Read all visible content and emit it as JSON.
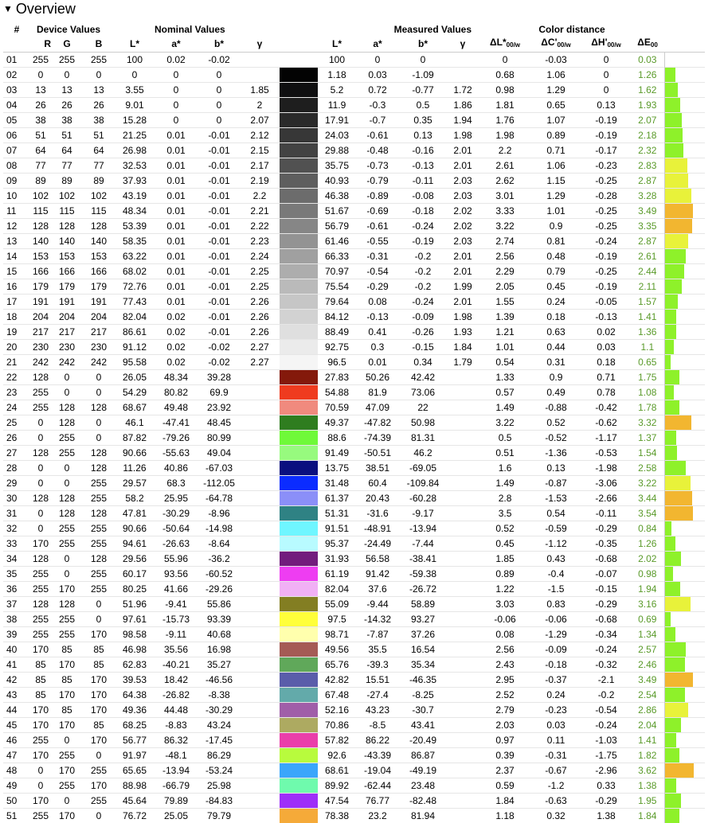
{
  "title": "Overview",
  "groups": {
    "device": "Device Values",
    "nominal": "Nominal Values",
    "measured": "Measured Values",
    "distance": "Color distance"
  },
  "columns": {
    "num": "#",
    "r": "R",
    "g": "G",
    "b": "B",
    "l": "L*",
    "a": "a*",
    "bstar": "b*",
    "gamma": "γ",
    "ml": "L*",
    "ma": "a*",
    "mb": "b*",
    "mgamma": "γ",
    "dl": "ΔL*",
    "dc": "ΔC'",
    "dh": "ΔH'",
    "de": "ΔE",
    "sub00w": "00/w",
    "sub00": "00"
  },
  "rows": [
    {
      "n": "01",
      "r": 255,
      "g": 255,
      "b": 255,
      "L": "100",
      "A": "0.02",
      "B": "-0.02",
      "gam": "",
      "sw": "#ffffff",
      "mL": "100",
      "mA": "0",
      "mB": "0",
      "mg": "",
      "dL": "0",
      "dC": "-0.03",
      "dH": "0",
      "dE": "0.03",
      "dEv": 0.03
    },
    {
      "n": "02",
      "r": 0,
      "g": 0,
      "b": 0,
      "L": "0",
      "A": "0",
      "B": "0",
      "gam": "",
      "sw": "#030303",
      "mL": "1.18",
      "mA": "0.03",
      "mB": "-1.09",
      "mg": "",
      "dL": "0.68",
      "dC": "1.06",
      "dH": "0",
      "dE": "1.26",
      "dEv": 1.26
    },
    {
      "n": "03",
      "r": 13,
      "g": 13,
      "b": 13,
      "L": "3.55",
      "A": "0",
      "B": "0",
      "gam": "1.85",
      "sw": "#0f0f10",
      "mL": "5.2",
      "mA": "0.72",
      "mB": "-0.77",
      "mg": "1.72",
      "dL": "0.98",
      "dC": "1.29",
      "dH": "0",
      "dE": "1.62",
      "dEv": 1.62
    },
    {
      "n": "04",
      "r": 26,
      "g": 26,
      "b": 26,
      "L": "9.01",
      "A": "0",
      "B": "0",
      "gam": "2",
      "sw": "#1e1e1e",
      "mL": "11.9",
      "mA": "-0.3",
      "mB": "0.5",
      "mg": "1.86",
      "dL": "1.81",
      "dC": "0.65",
      "dH": "0.13",
      "dE": "1.93",
      "dEv": 1.93
    },
    {
      "n": "05",
      "r": 38,
      "g": 38,
      "b": 38,
      "L": "15.28",
      "A": "0",
      "B": "0",
      "gam": "2.07",
      "sw": "#2a2a2a",
      "mL": "17.91",
      "mA": "-0.7",
      "mB": "0.35",
      "mg": "1.94",
      "dL": "1.76",
      "dC": "1.07",
      "dH": "-0.19",
      "dE": "2.07",
      "dEv": 2.07
    },
    {
      "n": "06",
      "r": 51,
      "g": 51,
      "b": 51,
      "L": "21.25",
      "A": "0.01",
      "B": "-0.01",
      "gam": "2.12",
      "sw": "#373737",
      "mL": "24.03",
      "mA": "-0.61",
      "mB": "0.13",
      "mg": "1.98",
      "dL": "1.98",
      "dC": "0.89",
      "dH": "-0.19",
      "dE": "2.18",
      "dEv": 2.18
    },
    {
      "n": "07",
      "r": 64,
      "g": 64,
      "b": 64,
      "L": "26.98",
      "A": "0.01",
      "B": "-0.01",
      "gam": "2.15",
      "sw": "#434343",
      "mL": "29.88",
      "mA": "-0.48",
      "mB": "-0.16",
      "mg": "2.01",
      "dL": "2.2",
      "dC": "0.71",
      "dH": "-0.17",
      "dE": "2.32",
      "dEv": 2.32
    },
    {
      "n": "08",
      "r": 77,
      "g": 77,
      "b": 77,
      "L": "32.53",
      "A": "0.01",
      "B": "-0.01",
      "gam": "2.17",
      "sw": "#515151",
      "mL": "35.75",
      "mA": "-0.73",
      "mB": "-0.13",
      "mg": "2.01",
      "dL": "2.61",
      "dC": "1.06",
      "dH": "-0.23",
      "dE": "2.83",
      "dEv": 2.83
    },
    {
      "n": "09",
      "r": 89,
      "g": 89,
      "b": 89,
      "L": "37.93",
      "A": "0.01",
      "B": "-0.01",
      "gam": "2.19",
      "sw": "#5e5e5e",
      "mL": "40.93",
      "mA": "-0.79",
      "mB": "-0.11",
      "mg": "2.03",
      "dL": "2.62",
      "dC": "1.15",
      "dH": "-0.25",
      "dE": "2.87",
      "dEv": 2.87
    },
    {
      "n": "10",
      "r": 102,
      "g": 102,
      "b": 102,
      "L": "43.19",
      "A": "0.01",
      "B": "-0.01",
      "gam": "2.2",
      "sw": "#6c6c6c",
      "mL": "46.38",
      "mA": "-0.89",
      "mB": "-0.08",
      "mg": "2.03",
      "dL": "3.01",
      "dC": "1.29",
      "dH": "-0.28",
      "dE": "3.28",
      "dEv": 3.28
    },
    {
      "n": "11",
      "r": 115,
      "g": 115,
      "b": 115,
      "L": "48.34",
      "A": "0.01",
      "B": "-0.01",
      "gam": "2.21",
      "sw": "#797979",
      "mL": "51.67",
      "mA": "-0.69",
      "mB": "-0.18",
      "mg": "2.02",
      "dL": "3.33",
      "dC": "1.01",
      "dH": "-0.25",
      "dE": "3.49",
      "dEv": 3.49
    },
    {
      "n": "12",
      "r": 128,
      "g": 128,
      "b": 128,
      "L": "53.39",
      "A": "0.01",
      "B": "-0.01",
      "gam": "2.22",
      "sw": "#868686",
      "mL": "56.79",
      "mA": "-0.61",
      "mB": "-0.24",
      "mg": "2.02",
      "dL": "3.22",
      "dC": "0.9",
      "dH": "-0.25",
      "dE": "3.35",
      "dEv": 3.35
    },
    {
      "n": "13",
      "r": 140,
      "g": 140,
      "b": 140,
      "L": "58.35",
      "A": "0.01",
      "B": "-0.01",
      "gam": "2.23",
      "sw": "#939393",
      "mL": "61.46",
      "mA": "-0.55",
      "mB": "-0.19",
      "mg": "2.03",
      "dL": "2.74",
      "dC": "0.81",
      "dH": "-0.24",
      "dE": "2.87",
      "dEv": 2.87
    },
    {
      "n": "14",
      "r": 153,
      "g": 153,
      "b": 153,
      "L": "63.22",
      "A": "0.01",
      "B": "-0.01",
      "gam": "2.24",
      "sw": "#a0a0a0",
      "mL": "66.33",
      "mA": "-0.31",
      "mB": "-0.2",
      "mg": "2.01",
      "dL": "2.56",
      "dC": "0.48",
      "dH": "-0.19",
      "dE": "2.61",
      "dEv": 2.61
    },
    {
      "n": "15",
      "r": 166,
      "g": 166,
      "b": 166,
      "L": "68.02",
      "A": "0.01",
      "B": "-0.01",
      "gam": "2.25",
      "sw": "#adadad",
      "mL": "70.97",
      "mA": "-0.54",
      "mB": "-0.2",
      "mg": "2.01",
      "dL": "2.29",
      "dC": "0.79",
      "dH": "-0.25",
      "dE": "2.44",
      "dEv": 2.44
    },
    {
      "n": "16",
      "r": 179,
      "g": 179,
      "b": 179,
      "L": "72.76",
      "A": "0.01",
      "B": "-0.01",
      "gam": "2.25",
      "sw": "#bababa",
      "mL": "75.54",
      "mA": "-0.29",
      "mB": "-0.2",
      "mg": "1.99",
      "dL": "2.05",
      "dC": "0.45",
      "dH": "-0.19",
      "dE": "2.11",
      "dEv": 2.11
    },
    {
      "n": "17",
      "r": 191,
      "g": 191,
      "b": 191,
      "L": "77.43",
      "A": "0.01",
      "B": "-0.01",
      "gam": "2.26",
      "sw": "#c6c6c6",
      "mL": "79.64",
      "mA": "0.08",
      "mB": "-0.24",
      "mg": "2.01",
      "dL": "1.55",
      "dC": "0.24",
      "dH": "-0.05",
      "dE": "1.57",
      "dEv": 1.57
    },
    {
      "n": "18",
      "r": 204,
      "g": 204,
      "b": 204,
      "L": "82.04",
      "A": "0.02",
      "B": "-0.01",
      "gam": "2.26",
      "sw": "#d2d2d2",
      "mL": "84.12",
      "mA": "-0.13",
      "mB": "-0.09",
      "mg": "1.98",
      "dL": "1.39",
      "dC": "0.18",
      "dH": "-0.13",
      "dE": "1.41",
      "dEv": 1.41
    },
    {
      "n": "19",
      "r": 217,
      "g": 217,
      "b": 217,
      "L": "86.61",
      "A": "0.02",
      "B": "-0.01",
      "gam": "2.26",
      "sw": "#dfdfdf",
      "mL": "88.49",
      "mA": "0.41",
      "mB": "-0.26",
      "mg": "1.93",
      "dL": "1.21",
      "dC": "0.63",
      "dH": "0.02",
      "dE": "1.36",
      "dEv": 1.36
    },
    {
      "n": "20",
      "r": 230,
      "g": 230,
      "b": 230,
      "L": "91.12",
      "A": "0.02",
      "B": "-0.02",
      "gam": "2.27",
      "sw": "#ebebeb",
      "mL": "92.75",
      "mA": "0.3",
      "mB": "-0.15",
      "mg": "1.84",
      "dL": "1.01",
      "dC": "0.44",
      "dH": "0.03",
      "dE": "1.1",
      "dEv": 1.1
    },
    {
      "n": "21",
      "r": 242,
      "g": 242,
      "b": 242,
      "L": "95.58",
      "A": "0.02",
      "B": "-0.02",
      "gam": "2.27",
      "sw": "#f5f5f5",
      "mL": "96.5",
      "mA": "0.01",
      "mB": "0.34",
      "mg": "1.79",
      "dL": "0.54",
      "dC": "0.31",
      "dH": "0.18",
      "dE": "0.65",
      "dEv": 0.65
    },
    {
      "n": "22",
      "r": 128,
      "g": 0,
      "b": 0,
      "L": "26.05",
      "A": "48.34",
      "B": "39.28",
      "gam": "",
      "sw": "#84190b",
      "mL": "27.83",
      "mA": "50.26",
      "mB": "42.42",
      "mg": "",
      "dL": "1.33",
      "dC": "0.9",
      "dH": "0.71",
      "dE": "1.75",
      "dEv": 1.75
    },
    {
      "n": "23",
      "r": 255,
      "g": 0,
      "b": 0,
      "L": "54.29",
      "A": "80.82",
      "B": "69.9",
      "gam": "",
      "sw": "#ef3b1f",
      "mL": "54.88",
      "mA": "81.9",
      "mB": "73.06",
      "mg": "",
      "dL": "0.57",
      "dC": "0.49",
      "dH": "0.78",
      "dE": "1.08",
      "dEv": 1.08
    },
    {
      "n": "24",
      "r": 255,
      "g": 128,
      "b": 128,
      "L": "68.67",
      "A": "49.48",
      "B": "23.92",
      "gam": "",
      "sw": "#f08a7e",
      "mL": "70.59",
      "mA": "47.09",
      "mB": "22",
      "mg": "",
      "dL": "1.49",
      "dC": "-0.88",
      "dH": "-0.42",
      "dE": "1.78",
      "dEv": 1.78
    },
    {
      "n": "25",
      "r": 0,
      "g": 128,
      "b": 0,
      "L": "46.1",
      "A": "-47.41",
      "B": "48.45",
      "gam": "",
      "sw": "#2f7d1f",
      "mL": "49.37",
      "mA": "-47.82",
      "mB": "50.98",
      "mg": "",
      "dL": "3.22",
      "dC": "0.52",
      "dH": "-0.62",
      "dE": "3.32",
      "dEv": 3.32
    },
    {
      "n": "26",
      "r": 0,
      "g": 255,
      "b": 0,
      "L": "87.82",
      "A": "-79.26",
      "B": "80.99",
      "gam": "",
      "sw": "#6ff939",
      "mL": "88.6",
      "mA": "-74.39",
      "mB": "81.31",
      "mg": "",
      "dL": "0.5",
      "dC": "-0.52",
      "dH": "-1.17",
      "dE": "1.37",
      "dEv": 1.37
    },
    {
      "n": "27",
      "r": 128,
      "g": 255,
      "b": 128,
      "L": "90.66",
      "A": "-55.63",
      "B": "49.04",
      "gam": "",
      "sw": "#97fa7e",
      "mL": "91.49",
      "mA": "-50.51",
      "mB": "46.2",
      "mg": "",
      "dL": "0.51",
      "dC": "-1.36",
      "dH": "-0.53",
      "dE": "1.54",
      "dEv": 1.54
    },
    {
      "n": "28",
      "r": 0,
      "g": 0,
      "b": 128,
      "L": "11.26",
      "A": "40.86",
      "B": "-67.03",
      "gam": "",
      "sw": "#0a0f7f",
      "mL": "13.75",
      "mA": "38.51",
      "mB": "-69.05",
      "mg": "",
      "dL": "1.6",
      "dC": "0.13",
      "dH": "-1.98",
      "dE": "2.58",
      "dEv": 2.58
    },
    {
      "n": "29",
      "r": 0,
      "g": 0,
      "b": 255,
      "L": "29.57",
      "A": "68.3",
      "B": "-112.05",
      "gam": "",
      "sw": "#0b2cff",
      "mL": "31.48",
      "mA": "60.4",
      "mB": "-109.84",
      "mg": "",
      "dL": "1.49",
      "dC": "-0.87",
      "dH": "-3.06",
      "dE": "3.22",
      "dEv": 3.22
    },
    {
      "n": "30",
      "r": 128,
      "g": 128,
      "b": 255,
      "L": "58.2",
      "A": "25.95",
      "B": "-64.78",
      "gam": "",
      "sw": "#8b8ff8",
      "mL": "61.37",
      "mA": "20.43",
      "mB": "-60.28",
      "mg": "",
      "dL": "2.8",
      "dC": "-1.53",
      "dH": "-2.66",
      "dE": "3.44",
      "dEv": 3.44
    },
    {
      "n": "31",
      "r": 0,
      "g": 128,
      "b": 128,
      "L": "47.81",
      "A": "-30.29",
      "B": "-8.96",
      "gam": "",
      "sw": "#2f8284",
      "mL": "51.31",
      "mA": "-31.6",
      "mB": "-9.17",
      "mg": "",
      "dL": "3.5",
      "dC": "0.54",
      "dH": "-0.11",
      "dE": "3.54",
      "dEv": 3.54
    },
    {
      "n": "32",
      "r": 0,
      "g": 255,
      "b": 255,
      "L": "90.66",
      "A": "-50.64",
      "B": "-14.98",
      "gam": "",
      "sw": "#6ff6ff",
      "mL": "91.51",
      "mA": "-48.91",
      "mB": "-13.94",
      "mg": "",
      "dL": "0.52",
      "dC": "-0.59",
      "dH": "-0.29",
      "dE": "0.84",
      "dEv": 0.84
    },
    {
      "n": "33",
      "r": 170,
      "g": 255,
      "b": 255,
      "L": "94.61",
      "A": "-26.63",
      "B": "-8.64",
      "gam": "",
      "sw": "#b8fbff",
      "mL": "95.37",
      "mA": "-24.49",
      "mB": "-7.44",
      "mg": "",
      "dL": "0.45",
      "dC": "-1.12",
      "dH": "-0.35",
      "dE": "1.26",
      "dEv": 1.26
    },
    {
      "n": "34",
      "r": 128,
      "g": 0,
      "b": 128,
      "L": "29.56",
      "A": "55.96",
      "B": "-36.2",
      "gam": "",
      "sw": "#721c7d",
      "mL": "31.93",
      "mA": "56.58",
      "mB": "-38.41",
      "mg": "",
      "dL": "1.85",
      "dC": "0.43",
      "dH": "-0.68",
      "dE": "2.02",
      "dEv": 2.02
    },
    {
      "n": "35",
      "r": 255,
      "g": 0,
      "b": 255,
      "L": "60.17",
      "A": "93.56",
      "B": "-60.52",
      "gam": "",
      "sw": "#ee3df2",
      "mL": "61.19",
      "mA": "91.42",
      "mB": "-59.38",
      "mg": "",
      "dL": "0.89",
      "dC": "-0.4",
      "dH": "-0.07",
      "dE": "0.98",
      "dEv": 0.98
    },
    {
      "n": "36",
      "r": 255,
      "g": 170,
      "b": 255,
      "L": "80.25",
      "A": "41.66",
      "B": "-29.26",
      "gam": "",
      "sw": "#f1b0f5",
      "mL": "82.04",
      "mA": "37.6",
      "mB": "-26.72",
      "mg": "",
      "dL": "1.22",
      "dC": "-1.5",
      "dH": "-0.15",
      "dE": "1.94",
      "dEv": 1.94
    },
    {
      "n": "37",
      "r": 128,
      "g": 128,
      "b": 0,
      "L": "51.96",
      "A": "-9.41",
      "B": "55.86",
      "gam": "",
      "sw": "#837e22",
      "mL": "55.09",
      "mA": "-9.44",
      "mB": "58.89",
      "mg": "",
      "dL": "3.03",
      "dC": "0.83",
      "dH": "-0.29",
      "dE": "3.16",
      "dEv": 3.16
    },
    {
      "n": "38",
      "r": 255,
      "g": 255,
      "b": 0,
      "L": "97.61",
      "A": "-15.73",
      "B": "93.39",
      "gam": "",
      "sw": "#ffff3a",
      "mL": "97.5",
      "mA": "-14.32",
      "mB": "93.27",
      "mg": "",
      "dL": "-0.06",
      "dC": "-0.06",
      "dH": "-0.68",
      "dE": "0.69",
      "dEv": 0.69
    },
    {
      "n": "39",
      "r": 255,
      "g": 255,
      "b": 170,
      "L": "98.58",
      "A": "-9.11",
      "B": "40.68",
      "gam": "",
      "sw": "#ffffad",
      "mL": "98.71",
      "mA": "-7.87",
      "mB": "37.26",
      "mg": "",
      "dL": "0.08",
      "dC": "-1.29",
      "dH": "-0.34",
      "dE": "1.34",
      "dEv": 1.34
    },
    {
      "n": "40",
      "r": 170,
      "g": 85,
      "b": 85,
      "L": "46.98",
      "A": "35.56",
      "B": "16.98",
      "gam": "",
      "sw": "#a55b55",
      "mL": "49.56",
      "mA": "35.5",
      "mB": "16.54",
      "mg": "",
      "dL": "2.56",
      "dC": "-0.09",
      "dH": "-0.24",
      "dE": "2.57",
      "dEv": 2.57
    },
    {
      "n": "41",
      "r": 85,
      "g": 170,
      "b": 85,
      "L": "62.83",
      "A": "-40.21",
      "B": "35.27",
      "gam": "",
      "sw": "#60a85a",
      "mL": "65.76",
      "mA": "-39.3",
      "mB": "35.34",
      "mg": "",
      "dL": "2.43",
      "dC": "-0.18",
      "dH": "-0.32",
      "dE": "2.46",
      "dEv": 2.46
    },
    {
      "n": "42",
      "r": 85,
      "g": 85,
      "b": 170,
      "L": "39.53",
      "A": "18.42",
      "B": "-46.56",
      "gam": "",
      "sw": "#5a5daa",
      "mL": "42.82",
      "mA": "15.51",
      "mB": "-46.35",
      "mg": "",
      "dL": "2.95",
      "dC": "-0.37",
      "dH": "-2.1",
      "dE": "3.49",
      "dEv": 3.49
    },
    {
      "n": "43",
      "r": 85,
      "g": 170,
      "b": 170,
      "L": "64.38",
      "A": "-26.82",
      "B": "-8.38",
      "gam": "",
      "sw": "#63aaaa",
      "mL": "67.48",
      "mA": "-27.4",
      "mB": "-8.25",
      "mg": "",
      "dL": "2.52",
      "dC": "0.24",
      "dH": "-0.2",
      "dE": "2.54",
      "dEv": 2.54
    },
    {
      "n": "44",
      "r": 170,
      "g": 85,
      "b": 170,
      "L": "49.36",
      "A": "44.48",
      "B": "-30.29",
      "gam": "",
      "sw": "#a05ea8",
      "mL": "52.16",
      "mA": "43.23",
      "mB": "-30.7",
      "mg": "",
      "dL": "2.79",
      "dC": "-0.23",
      "dH": "-0.54",
      "dE": "2.86",
      "dEv": 2.86
    },
    {
      "n": "45",
      "r": 170,
      "g": 170,
      "b": 85,
      "L": "68.25",
      "A": "-8.83",
      "B": "43.24",
      "gam": "",
      "sw": "#adaa61",
      "mL": "70.86",
      "mA": "-8.5",
      "mB": "43.41",
      "mg": "",
      "dL": "2.03",
      "dC": "0.03",
      "dH": "-0.24",
      "dE": "2.04",
      "dEv": 2.04
    },
    {
      "n": "46",
      "r": 255,
      "g": 0,
      "b": 170,
      "L": "56.77",
      "A": "86.32",
      "B": "-17.45",
      "gam": "",
      "sw": "#ea3eaa",
      "mL": "57.82",
      "mA": "86.22",
      "mB": "-20.49",
      "mg": "",
      "dL": "0.97",
      "dC": "0.11",
      "dH": "-1.03",
      "dE": "1.41",
      "dEv": 1.41
    },
    {
      "n": "47",
      "r": 170,
      "g": 255,
      "b": 0,
      "L": "91.97",
      "A": "-48.1",
      "B": "86.29",
      "gam": "",
      "sw": "#b8fb3d",
      "mL": "92.6",
      "mA": "-43.39",
      "mB": "86.87",
      "mg": "",
      "dL": "0.39",
      "dC": "-0.31",
      "dH": "-1.75",
      "dE": "1.82",
      "dEv": 1.82
    },
    {
      "n": "48",
      "r": 0,
      "g": 170,
      "b": 255,
      "L": "65.65",
      "A": "-13.94",
      "B": "-53.24",
      "gam": "",
      "sw": "#3aa6fb",
      "mL": "68.61",
      "mA": "-19.04",
      "mB": "-49.19",
      "mg": "",
      "dL": "2.37",
      "dC": "-0.67",
      "dH": "-2.96",
      "dE": "3.62",
      "dEv": 3.62
    },
    {
      "n": "49",
      "r": 0,
      "g": 255,
      "b": 170,
      "L": "88.98",
      "A": "-66.79",
      "B": "25.98",
      "gam": "",
      "sw": "#6ffaad",
      "mL": "89.92",
      "mA": "-62.44",
      "mB": "23.48",
      "mg": "",
      "dL": "0.59",
      "dC": "-1.2",
      "dH": "0.33",
      "dE": "1.38",
      "dEv": 1.38
    },
    {
      "n": "50",
      "r": 170,
      "g": 0,
      "b": 255,
      "L": "45.64",
      "A": "79.89",
      "B": "-84.83",
      "gam": "",
      "sw": "#9e2ff8",
      "mL": "47.54",
      "mA": "76.77",
      "mB": "-82.48",
      "mg": "",
      "dL": "1.84",
      "dC": "-0.63",
      "dH": "-0.29",
      "dE": "1.95",
      "dEv": 1.95
    },
    {
      "n": "51",
      "r": 255,
      "g": 170,
      "b": 0,
      "L": "76.72",
      "A": "25.05",
      "B": "79.79",
      "gam": "",
      "sw": "#f5aa39",
      "mL": "78.38",
      "mA": "23.2",
      "mB": "81.94",
      "mg": "",
      "dL": "1.18",
      "dC": "0.32",
      "dH": "1.38",
      "dE": "1.84",
      "dEv": 1.84
    }
  ],
  "bar_colors": {
    "low": "#8ef12a",
    "mid": "#e8f23a",
    "high": "#f2b630"
  }
}
